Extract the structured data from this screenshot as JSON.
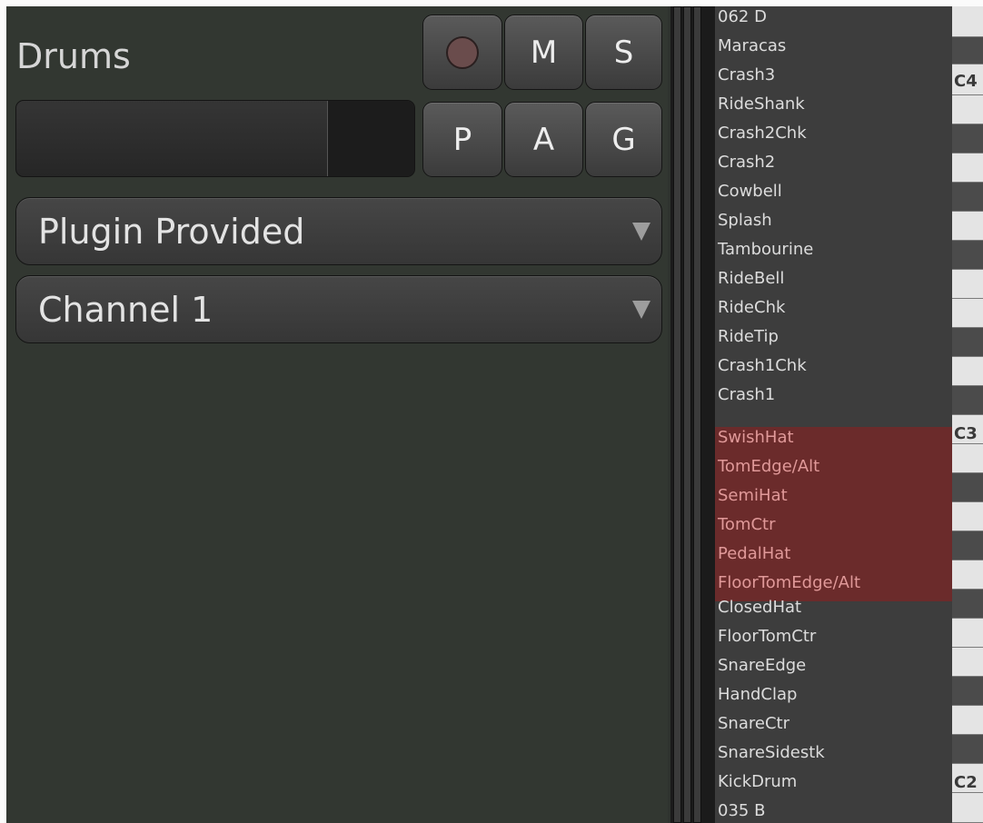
{
  "track": {
    "name": "Drums",
    "buttons": {
      "mute": "M",
      "solo": "S",
      "playlist": "P",
      "automation": "A",
      "group": "G"
    },
    "record_color": "#6a4c4c"
  },
  "dropdowns": {
    "note_mode": "Plugin Provided",
    "channel": "Channel 1"
  },
  "note_names": [
    "062 D",
    "Maracas",
    "Crash3",
    "RideShank",
    "Crash2Chk",
    "Crash2",
    "Cowbell",
    "Splash",
    "Tambourine",
    "RideBell",
    "RideChk",
    "RideTip",
    "Crash1Chk",
    "Crash1",
    "SwishHat",
    "TomEdge/Alt",
    "SemiHat",
    "TomCtr",
    "PedalHat",
    "FloorTomEdge/Alt",
    "ClosedHat",
    "FloorTomCtr",
    "SnareEdge",
    "HandClap",
    "SnareCtr",
    "SnareSidestk",
    "KickDrum",
    "035 B"
  ],
  "selected_range": [
    "SwishHat",
    "FloorTomEdge/Alt"
  ],
  "piano_labels": {
    "c4": "C4",
    "c3": "C3",
    "c2": "C2"
  },
  "colors": {
    "selection": "#6b2b2b",
    "selected_text": "#e09999"
  }
}
